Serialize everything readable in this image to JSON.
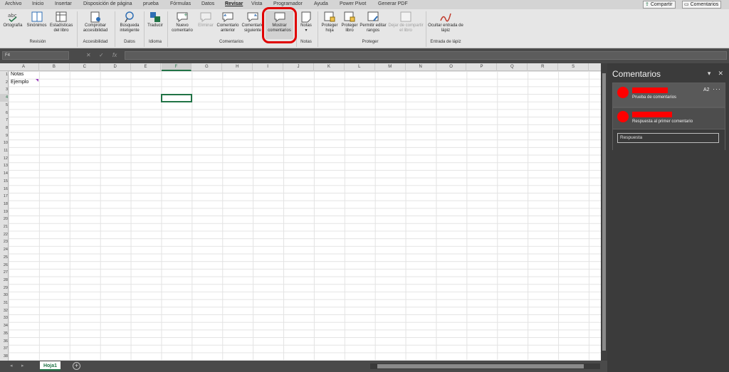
{
  "tabs": [
    "Archivo",
    "Inicio",
    "Insertar",
    "Disposición de página",
    "prueba",
    "Fórmulas",
    "Datos",
    "Revisar",
    "Vista",
    "Programador",
    "Ayuda",
    "Power Pivot",
    "Generar PDF"
  ],
  "active_tab": "Revisar",
  "top_buttons": {
    "share": "Compartir",
    "comments": "Comentarios"
  },
  "ribbon": {
    "buttons": {
      "spelling": "Ortografía",
      "synonyms": "Sinónimos",
      "stats": "Estadísticas del libro",
      "accessibility": "Comprobar accesibilidad",
      "smart_lookup": "Búsqueda inteligente",
      "translate": "Traducir",
      "new_comment": "Nuevo comentario",
      "delete": "Eliminar",
      "prev_comment": "Comentario anterior",
      "next_comment": "Comentario siguiente",
      "show_comments": "Mostrar comentarios",
      "notes": "Notas",
      "protect_sheet": "Proteger hoja",
      "protect_book": "Proteger libro",
      "allow_ranges": "Permitir editar rangos",
      "unshare": "Dejar de compartir el libro",
      "hide_ink": "Ocultar entrada de lápiz"
    },
    "groups": {
      "revision": "Revisión",
      "accessibility": "Accesibilidad",
      "data": "Datos",
      "language": "Idioma",
      "comments": "Comentarios",
      "notes": "Notas",
      "protect": "Proteger",
      "ink": "Entrada de lápiz"
    }
  },
  "formula_bar": {
    "name_box": "F4",
    "fx": "fx"
  },
  "columns": [
    "A",
    "B",
    "C",
    "D",
    "E",
    "F",
    "G",
    "H",
    "I",
    "J",
    "K",
    "L",
    "M",
    "N",
    "O",
    "P",
    "Q",
    "R",
    "S"
  ],
  "rows_count": 38,
  "selected": {
    "column": "F",
    "row": 4
  },
  "cells": {
    "A1": "Notas",
    "A2": "Ejemplo"
  },
  "sheet_tab": "Hoja1",
  "comments_panel": {
    "title": "Comentarios",
    "thread": {
      "ref": "A2",
      "first_comment": "Prueba de comentarios",
      "reply_comment": "Respuesta al primer comentario",
      "reply_placeholder": "Respuesta"
    }
  },
  "colors": {
    "accent": "#217346",
    "highlight": "#e00000",
    "redaction": "#ff0000"
  }
}
